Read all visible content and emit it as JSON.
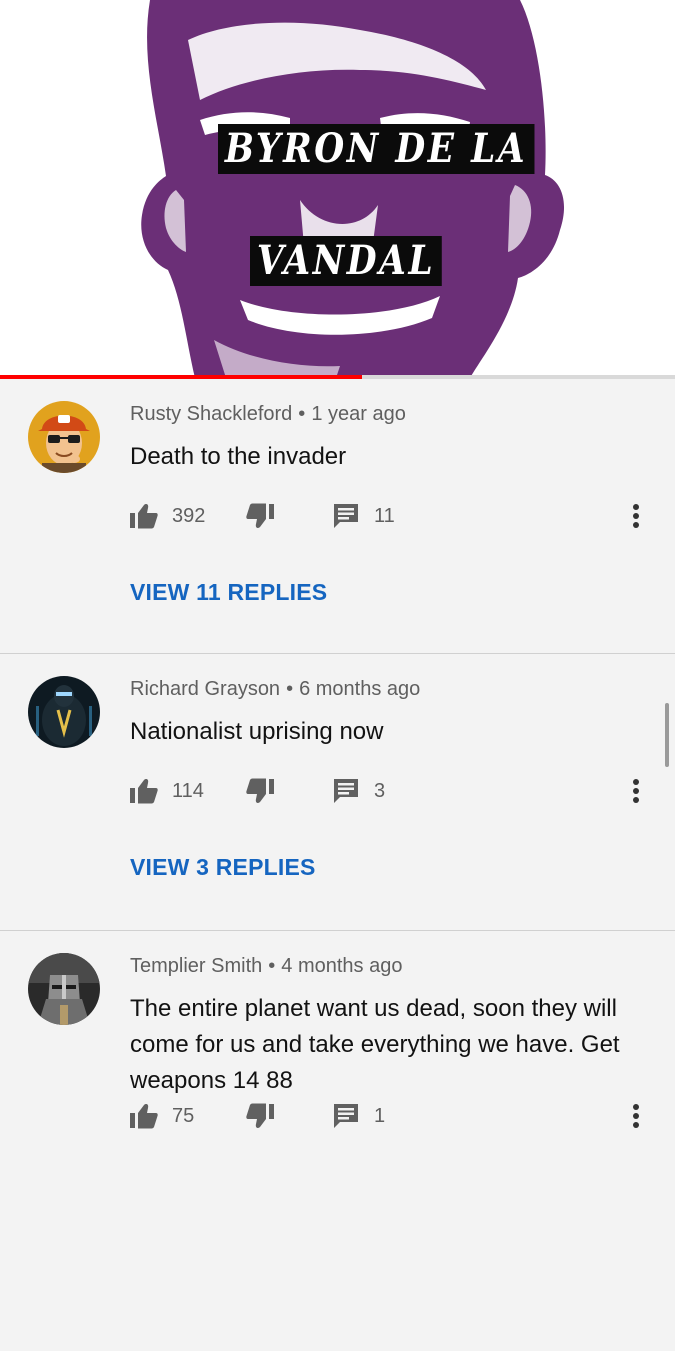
{
  "video": {
    "title_line1": "BYRON DE LA",
    "title_line2": "VANDAL",
    "progress_fraction": 0.536,
    "accent_color": "#ff0000"
  },
  "comments": [
    {
      "author": "Rusty Shackleford",
      "time": "1 year ago",
      "text": "Death to the invader",
      "likes": "392",
      "replies_count": "11",
      "view_replies": "VIEW 11 REPLIES",
      "avatar_icon": "cartoon-man-cap-avatar"
    },
    {
      "author": "Richard Grayson",
      "time": "6 months ago",
      "text": "Nationalist uprising now",
      "likes": "114",
      "replies_count": "3",
      "view_replies": "VIEW 3 REPLIES",
      "avatar_icon": "dark-figure-avatar"
    },
    {
      "author": "Templier Smith",
      "time": "4 months ago",
      "text": "The entire planet want us dead, soon they will come for us and take everything we have. Get weapons 14 88",
      "likes": "75",
      "replies_count": "1",
      "avatar_icon": "knight-helmet-avatar"
    }
  ],
  "icons": {
    "like": "thumbs-up-icon",
    "dislike": "thumbs-down-icon",
    "reply": "reply-comment-icon",
    "more": "more-vert-icon"
  },
  "colors": {
    "link": "#1565c0",
    "meta": "#5f5f5f",
    "background": "#f3f3f3"
  }
}
